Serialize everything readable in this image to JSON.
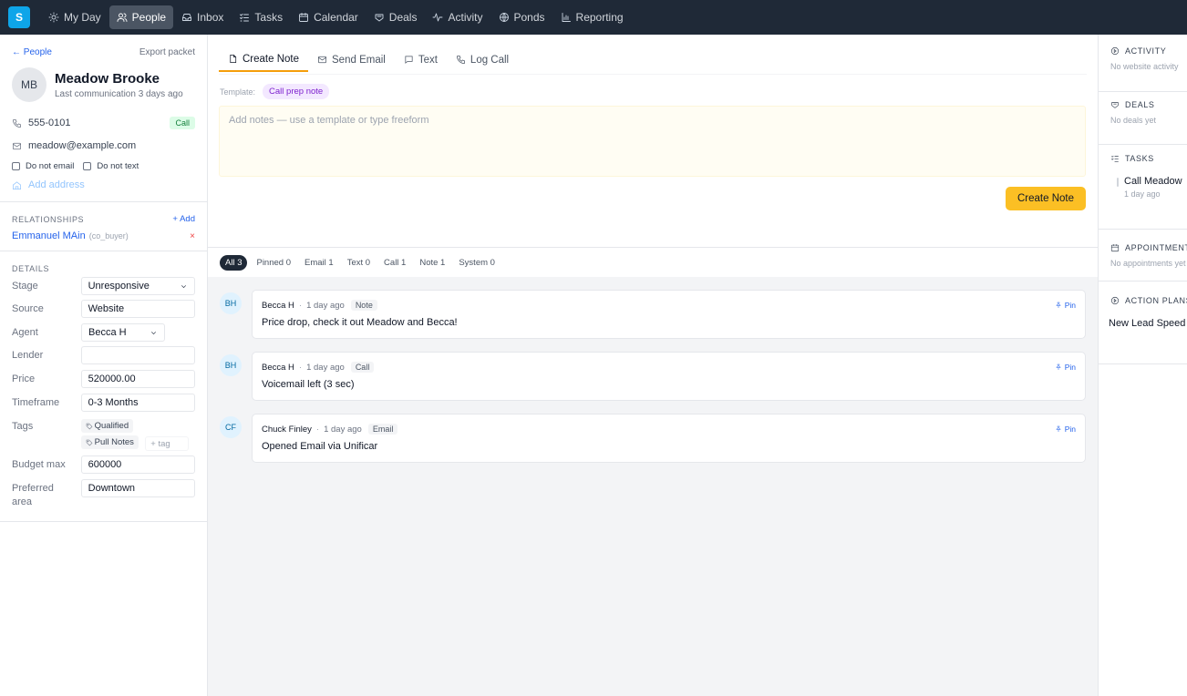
{
  "nav": {
    "logo": "S",
    "items": [
      {
        "label": "My Day",
        "icon": "sun-icon"
      },
      {
        "label": "People",
        "icon": "people-icon",
        "active": true
      },
      {
        "label": "Inbox",
        "icon": "inbox-icon"
      },
      {
        "label": "Tasks",
        "icon": "tasks-icon"
      },
      {
        "label": "Calendar",
        "icon": "calendar-icon"
      },
      {
        "label": "Deals",
        "icon": "deals-icon"
      },
      {
        "label": "Activity",
        "icon": "activity-icon"
      },
      {
        "label": "Ponds",
        "icon": "ponds-icon"
      },
      {
        "label": "Reporting",
        "icon": "reporting-icon"
      }
    ]
  },
  "contact": {
    "back_label": "← People",
    "export_label": "Export packet",
    "initials": "MB",
    "name": "Meadow Brooke",
    "last_comm": "Last communication 3 days ago",
    "phone": "555-0101",
    "call_badge": "Call",
    "email": "meadow@example.com",
    "do_not_email": "Do not email",
    "do_not_text": "Do not text",
    "add_address": "Add address"
  },
  "relationships": {
    "title": "RELATIONSHIPS",
    "add_label": "+ Add",
    "items": [
      {
        "name": "Emmanuel MAin",
        "type": "(co_buyer)",
        "remove": "×"
      }
    ]
  },
  "details": {
    "title": "DETAILS",
    "stage": {
      "label": "Stage",
      "value": "Unresponsive"
    },
    "source": {
      "label": "Source",
      "value": "Website"
    },
    "agent": {
      "label": "Agent",
      "value": "Becca H"
    },
    "lender": {
      "label": "Lender",
      "value": ""
    },
    "price": {
      "label": "Price",
      "value": "520000.00"
    },
    "timeframe": {
      "label": "Timeframe",
      "value": "0-3 Months"
    },
    "tags": {
      "label": "Tags",
      "items": [
        "Qualified",
        "Pull Notes"
      ],
      "placeholder": "+ tag"
    },
    "budget_max": {
      "label": "Budget max",
      "value": "600000"
    },
    "preferred_area": {
      "label": "Preferred area",
      "value": "Downtown"
    }
  },
  "composer": {
    "tabs": [
      {
        "label": "Create Note",
        "icon": "note-icon",
        "active": true
      },
      {
        "label": "Send Email",
        "icon": "email-icon"
      },
      {
        "label": "Text",
        "icon": "chat-icon"
      },
      {
        "label": "Log Call",
        "icon": "phone-icon"
      }
    ],
    "template_label": "Template:",
    "template_value": "Call prep note",
    "placeholder": "Add notes — use a template or type freeform",
    "submit_label": "Create Note"
  },
  "filters": [
    "All 3",
    "Pinned 0",
    "Email 1",
    "Text 0",
    "Call 1",
    "Note 1",
    "System 0"
  ],
  "feed": [
    {
      "initials": "BH",
      "author": "Becca H",
      "time": "1 day ago",
      "type": "Note",
      "pin": "Pin",
      "body": "Price drop, check it out Meadow and Becca!"
    },
    {
      "initials": "BH",
      "author": "Becca H",
      "time": "1 day ago",
      "type": "Call",
      "pin": "Pin",
      "body": "Voicemail left (3 sec)"
    },
    {
      "initials": "CF",
      "author": "Chuck Finley",
      "time": "1 day ago",
      "type": "Email",
      "pin": "Pin",
      "body": "Opened Email via Unificar"
    }
  ],
  "sidebar": {
    "activity": {
      "title": "ACTIVITY",
      "empty": "No website activity"
    },
    "deals": {
      "title": "DEALS",
      "empty": "No deals yet"
    },
    "tasks": {
      "title": "TASKS",
      "item": "Call Meadow",
      "item_sub": "1 day ago"
    },
    "appointments": {
      "title": "APPOINTMENTS",
      "empty": "No appointments yet"
    },
    "action_plans": {
      "title": "ACTION PLANS",
      "item": "New Lead Speed"
    }
  }
}
